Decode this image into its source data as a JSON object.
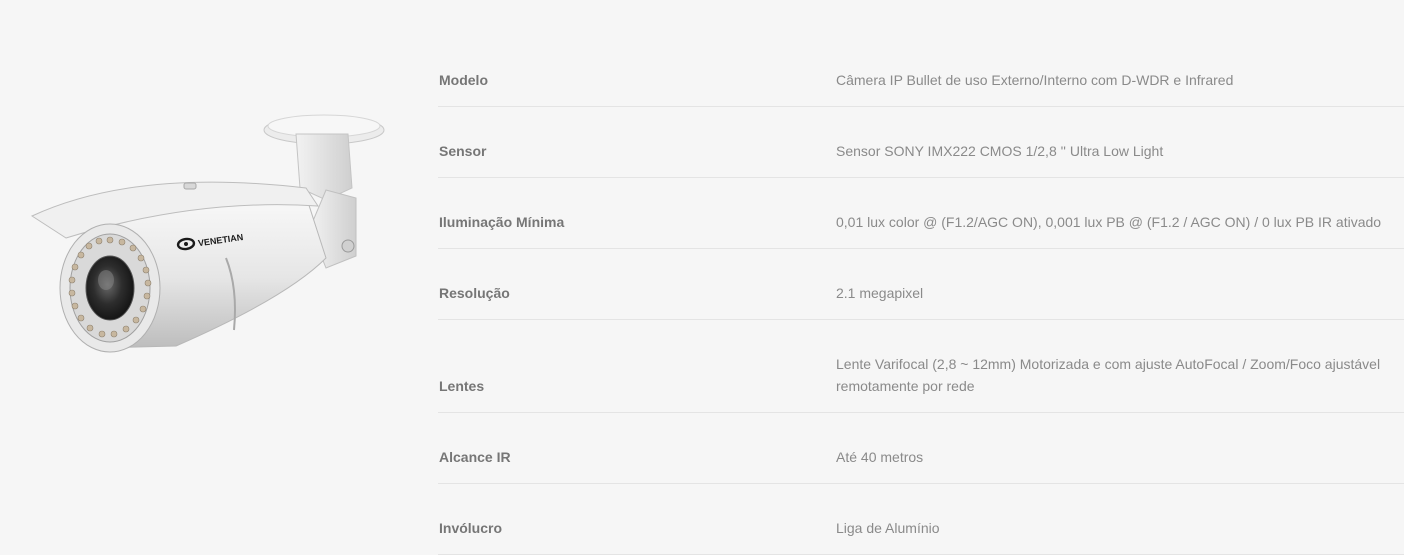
{
  "product": {
    "image_alt": "Câmera IP Bullet Venetian",
    "brand_logo_text": "VENETIAN"
  },
  "specs": [
    {
      "label": "Modelo",
      "value": "Câmera IP Bullet de uso Externo/Interno com D-WDR e Infrared"
    },
    {
      "label": "Sensor",
      "value": "Sensor SONY IMX222 CMOS 1/2,8 '' Ultra Low Light"
    },
    {
      "label": "Iluminação Mínima",
      "value": "0,01 lux color @ (F1.2/AGC ON), 0,001 lux PB @ (F1.2 / AGC ON) / 0 lux PB IR ativado"
    },
    {
      "label": "Resolução",
      "value": "2.1 megapixel"
    },
    {
      "label": "Lentes",
      "value": "Lente Varifocal (2,8 ~ 12mm) Motorizada e com ajuste AutoFocal / Zoom/Foco ajustável remotamente por rede"
    },
    {
      "label": "Alcance IR",
      "value": "Até 40 metros"
    },
    {
      "label": "Invólucro",
      "value": "Liga de Alumínio"
    }
  ]
}
